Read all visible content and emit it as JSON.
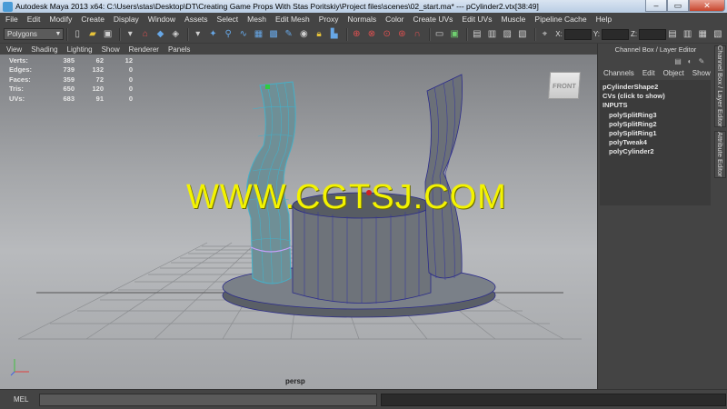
{
  "window": {
    "title": "Autodesk Maya 2013 x64: C:\\Users\\stas\\Desktop\\DT\\Creating Game Props With Stas Poritskiy\\Project files\\scenes\\02_start.ma*  ---  pCylinder2.vtx[38:49]"
  },
  "menubar": [
    "File",
    "Edit",
    "Modify",
    "Create",
    "Display",
    "Window",
    "Assets",
    "Select",
    "Mesh",
    "Edit Mesh",
    "Proxy",
    "Normals",
    "Color",
    "Create UVs",
    "Edit UVs",
    "Muscle",
    "Pipeline Cache",
    "Help"
  ],
  "toolbar": {
    "mode": "Polygons",
    "coords": [
      "X:",
      "Y:",
      "Z:"
    ]
  },
  "panel_menu": [
    "View",
    "Shading",
    "Lighting",
    "Show",
    "Renderer",
    "Panels"
  ],
  "hud": {
    "rows": [
      {
        "label": "Verts:",
        "v1": "385",
        "v2": "62",
        "v3": "12"
      },
      {
        "label": "Edges:",
        "v1": "739",
        "v2": "132",
        "v3": "0"
      },
      {
        "label": "Faces:",
        "v1": "359",
        "v2": "72",
        "v3": "0"
      },
      {
        "label": "Tris:",
        "v1": "650",
        "v2": "120",
        "v3": "0"
      },
      {
        "label": "UVs:",
        "v1": "683",
        "v2": "91",
        "v3": "0"
      }
    ]
  },
  "viewcube": {
    "label": "FRONT"
  },
  "camera": {
    "label": "persp"
  },
  "watermark": "WWW.CGTSJ.COM",
  "channel_box": {
    "header": "Channel Box / Layer Editor",
    "menu": [
      "Channels",
      "Edit",
      "Object",
      "Show"
    ],
    "object": "pCylinderShape2",
    "cvs": "CVs (click to show)",
    "inputs_label": "INPUTS",
    "inputs": [
      "polySplitRing3",
      "polySplitRing2",
      "polySplitRing1",
      "polyTweak4",
      "polyCylinder2"
    ]
  },
  "side_tabs": [
    "Channel Box / Layer Editor",
    "Attribute Editor"
  ],
  "bottom": {
    "mel_label": "MEL"
  },
  "colors": {
    "watermark": "#f3f300",
    "selected_wire": "#45b0c8"
  }
}
